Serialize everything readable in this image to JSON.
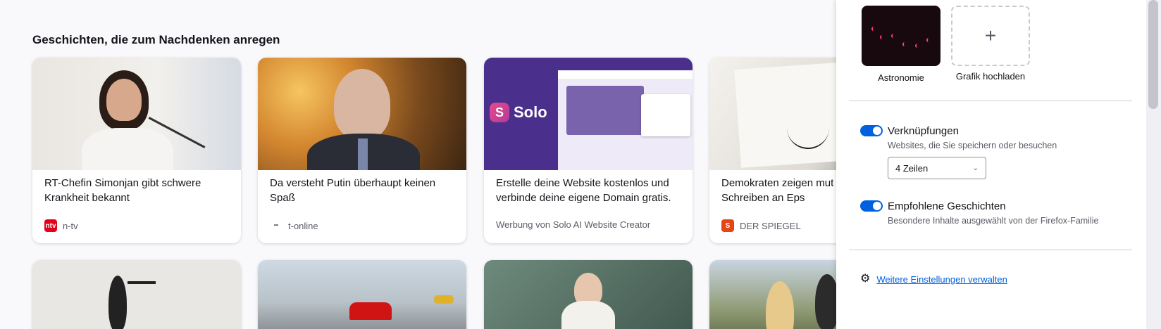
{
  "feed": {
    "section_title": "Geschichten, die zum Nachdenken anregen",
    "cards": [
      {
        "title": "RT-Chefin Simonjan gibt schwere Krankheit bekannt",
        "source": "n-tv",
        "source_icon": "ntv"
      },
      {
        "title": "Da versteht Putin überhaupt keinen Spaß",
        "source": "t-online",
        "source_icon": "t-online"
      },
      {
        "title": "Erstelle deine Website kostenlos und verbinde deine eigene Domain gratis.",
        "source": "Werbung von Solo AI Website Creator",
        "source_icon": ""
      },
      {
        "title": "Demokraten zeigen mut Trump-Schreiben an Eps",
        "source": "DER SPIEGEL",
        "source_icon": "S"
      }
    ],
    "solo_brand": "Solo",
    "ntv_icon_text": "ntv",
    "spiegel_icon_text": "S"
  },
  "settings": {
    "wallpapers": [
      {
        "label": "Astronomie"
      },
      {
        "label": "Grafik hochladen",
        "icon_text": "+"
      }
    ],
    "shortcuts": {
      "title": "Verknüpfungen",
      "description": "Websites, die Sie speichern oder besuchen",
      "rows_value": "4 Zeilen",
      "enabled": true
    },
    "stories": {
      "title": "Empfohlene Geschichten",
      "description": "Besondere Inhalte ausgewählt von der Firefox-Familie",
      "enabled": true
    },
    "manage_link": "Weitere Einstellungen verwalten"
  },
  "colors": {
    "accent": "#0061e0",
    "ntv_red": "#e2001a",
    "spiegel_orange": "#e64415"
  }
}
